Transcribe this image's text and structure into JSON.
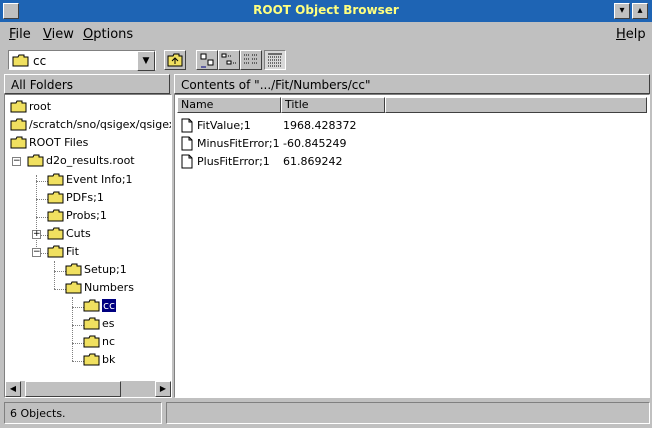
{
  "window": {
    "title": "ROOT Object Browser"
  },
  "menu": {
    "file": "File",
    "view": "View",
    "options": "Options",
    "help": "Help"
  },
  "toolbar": {
    "combo_value": "cc"
  },
  "left_panel": {
    "header": "All Folders"
  },
  "right_panel": {
    "header": "Contents of \".../Fit/Numbers/cc\""
  },
  "tree": [
    {
      "label": "root"
    },
    {
      "label": "/scratch/sno/qsigex/qsigex_new"
    },
    {
      "label": "ROOT Files"
    },
    {
      "label": "d2o_results.root"
    },
    {
      "label": "Event Info;1"
    },
    {
      "label": "PDFs;1"
    },
    {
      "label": "Probs;1"
    },
    {
      "label": "Cuts"
    },
    {
      "label": "Fit"
    },
    {
      "label": "Setup;1"
    },
    {
      "label": "Numbers"
    },
    {
      "label": "cc"
    },
    {
      "label": "es"
    },
    {
      "label": "nc"
    },
    {
      "label": "bk"
    }
  ],
  "list": {
    "columns": [
      "Name",
      "Title"
    ],
    "rows": [
      {
        "name": "FitValue;1",
        "title": "1968.428372"
      },
      {
        "name": "MinusFitError;1",
        "title": "-60.845249"
      },
      {
        "name": "PlusFitError;1",
        "title": "61.869242"
      }
    ]
  },
  "status": {
    "objects": "6 Objects."
  },
  "colors": {
    "titlebar": "#1e64b4",
    "title_text": "#ffff7f",
    "folder": "#f0e060",
    "selection": "#000080"
  }
}
